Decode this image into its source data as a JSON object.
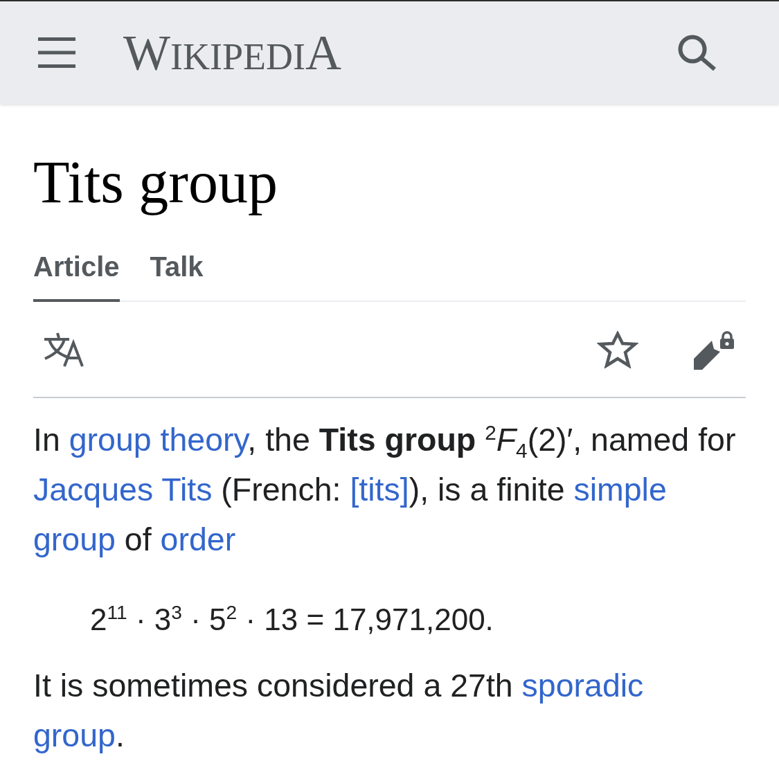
{
  "header": {
    "logo": "WIKIPEDIA"
  },
  "page_title": "Tits group",
  "tabs": [
    {
      "label": "Article",
      "selected": true
    },
    {
      "label": "Talk",
      "selected": false
    }
  ],
  "content": [
    {
      "kind": "paragraph",
      "parts": [
        {
          "kind": "text",
          "text": "In "
        },
        {
          "kind": "link",
          "text": "group theory"
        },
        {
          "kind": "text",
          "text": ", the **Tits group** $^{2}$*F*$_{4}$(2)′, named for "
        },
        {
          "kind": "link",
          "text": "Jacques Tits"
        },
        {
          "kind": "text",
          "text": " (French: "
        },
        {
          "kind": "link",
          "text": "[tits]"
        },
        {
          "kind": "text",
          "text": "), is a finite "
        },
        {
          "kind": "link",
          "text": "simple "
        },
        {
          "kind": "link",
          "text": "group"
        },
        {
          "kind": "text",
          "text": " of "
        },
        {
          "kind": "link",
          "text": "order"
        }
      ]
    },
    {
      "kind": "formula",
      "text": "2$^{11}$ · 3$^{3}$ · 5$^{2}$ · 13 = 17,971,200."
    },
    {
      "kind": "paragraph",
      "parts": [
        {
          "kind": "text",
          "text": "It is sometimes considered a 27th "
        },
        {
          "kind": "link",
          "text": "sporadic "
        },
        {
          "kind": "link",
          "text": "group"
        },
        {
          "kind": "text",
          "text": "."
        }
      ]
    }
  ]
}
